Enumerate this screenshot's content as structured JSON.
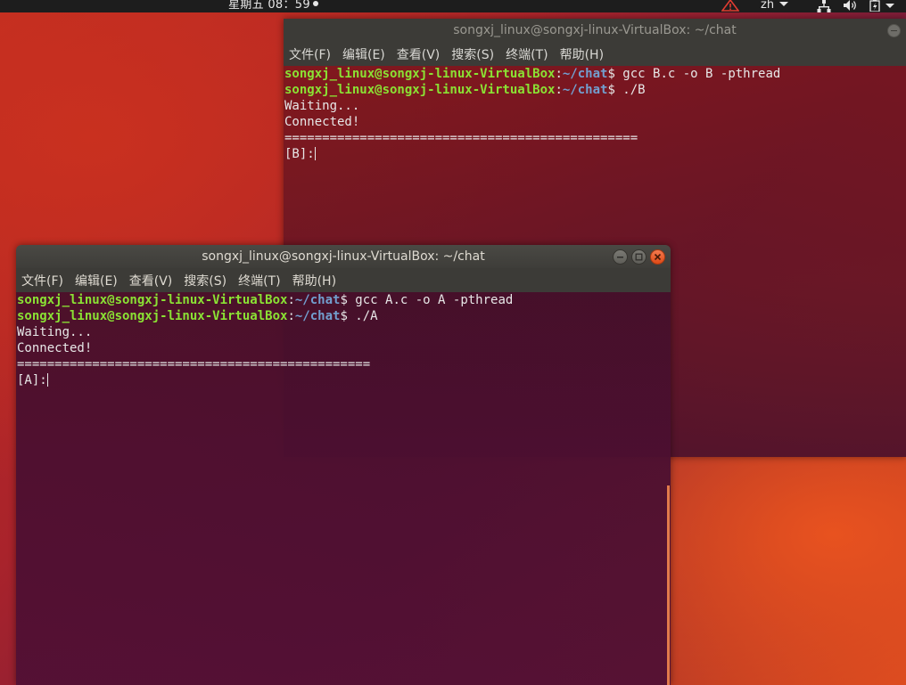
{
  "topbar": {
    "clock": "星期五 08：59",
    "language": "zh"
  },
  "window_b": {
    "title": "songxj_linux@songxj-linux-VirtualBox: ~/chat",
    "menu": [
      "文件(F)",
      "编辑(E)",
      "查看(V)",
      "搜索(S)",
      "终端(T)",
      "帮助(H)"
    ],
    "lines": [
      {
        "user": "songxj_linux@songxj-linux-VirtualBox",
        "sep": ":",
        "path": "~/chat",
        "cmd": "$ gcc B.c -o B -pthread"
      },
      {
        "user": "songxj_linux@songxj-linux-VirtualBox",
        "sep": ":",
        "path": "~/chat",
        "cmd": "$ ./B"
      }
    ],
    "output": [
      "Waiting...",
      "Connected!",
      "===============================================",
      "[B]:"
    ]
  },
  "window_a": {
    "title": "songxj_linux@songxj-linux-VirtualBox: ~/chat",
    "menu": [
      "文件(F)",
      "编辑(E)",
      "查看(V)",
      "搜索(S)",
      "终端(T)",
      "帮助(H)"
    ],
    "lines": [
      {
        "user": "songxj_linux@songxj-linux-VirtualBox",
        "sep": ":",
        "path": "~/chat",
        "cmd": "$ gcc A.c -o A -pthread"
      },
      {
        "user": "songxj_linux@songxj-linux-VirtualBox",
        "sep": ":",
        "path": "~/chat",
        "cmd": "$ ./A"
      }
    ],
    "output": [
      "Waiting...",
      "Connected!",
      "===============================================",
      "[A]:"
    ]
  },
  "colors": {
    "prompt_user": "#8ae234",
    "prompt_path": "#729fcf",
    "close_button": "#df4a16",
    "topbar": "#1d1d1d"
  },
  "icons": [
    "warning-icon",
    "caret-down-icon",
    "network-icon",
    "volume-icon",
    "battery-icon",
    "minimize-icon",
    "maximize-icon",
    "close-icon"
  ]
}
